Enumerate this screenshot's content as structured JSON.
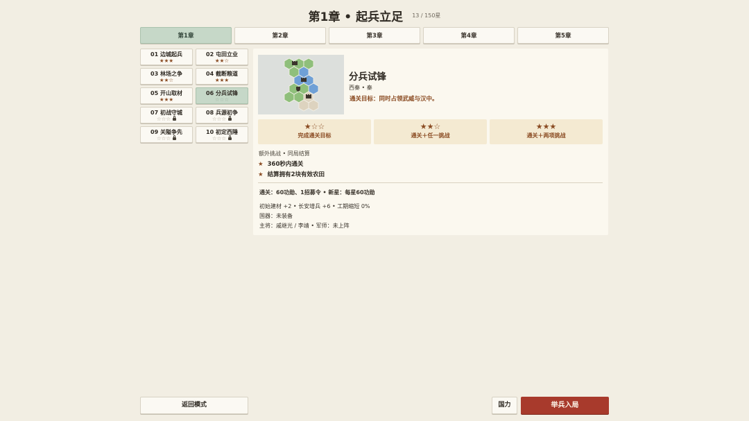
{
  "header": {
    "title": "第1章 • 起兵立足",
    "progress": "13 / 150星"
  },
  "chapter_tabs": [
    {
      "label": "第1章",
      "active": true
    },
    {
      "label": "第2章",
      "active": false
    },
    {
      "label": "第3章",
      "active": false
    },
    {
      "label": "第4章",
      "active": false
    },
    {
      "label": "第5章",
      "active": false
    }
  ],
  "levels": [
    {
      "name": "01  边城起兵",
      "stars": "★★★",
      "locked": false,
      "earned_stars": 3
    },
    {
      "name": "02  屯田立业",
      "stars": "★★☆",
      "locked": false,
      "earned_stars": 2
    },
    {
      "name": "03  林场之争",
      "stars": "★★☆",
      "locked": false,
      "earned_stars": 2
    },
    {
      "name": "04  截断粮道",
      "stars": "★★★",
      "locked": false,
      "earned_stars": 3
    },
    {
      "name": "05  开山取材",
      "stars": "★★★",
      "locked": false,
      "earned_stars": 3
    },
    {
      "name": "06  分兵试锋",
      "stars": "☆☆☆",
      "locked": false,
      "earned_stars": 0,
      "selected": true
    },
    {
      "name": "07  初战守城",
      "stars": "☆☆☆",
      "locked": true,
      "earned_stars": 0
    },
    {
      "name": "08  兵源初争",
      "stars": "☆☆☆",
      "locked": true,
      "earned_stars": 0
    },
    {
      "name": "09  关隘争先",
      "stars": "☆☆☆",
      "locked": true,
      "earned_stars": 0
    },
    {
      "name": "10  初定西陲",
      "stars": "☆☆☆",
      "locked": true,
      "earned_stars": 0
    }
  ],
  "detail": {
    "title": "分兵试锋",
    "factions": "西秦 • 秦",
    "objective": "通关目标：同时占领武威与汉中。",
    "tiers": [
      {
        "stars": "★☆☆",
        "label": "完成通关目标"
      },
      {
        "stars": "★★☆",
        "label": "通关＋任一挑战"
      },
      {
        "stars": "★★★",
        "label": "通关＋两项挑战"
      }
    ],
    "extra_heading": "额外挑战 • 同局结算",
    "challenges": [
      {
        "star": "★",
        "text": "360秒内通关"
      },
      {
        "star": "★",
        "text": "结算拥有2块有效农田"
      }
    ],
    "rewards": "通关：60功勋、1招募令 • 新星：每星60功勋",
    "bonuses": "初始建材 +2 • 长安增兵 +6 • 工期缩短 0%",
    "equipment": "国器：未装备",
    "commanders": "主将：戚继光 / 李靖 • 军师：未上阵"
  },
  "footer": {
    "back_label": "返回模式",
    "guoli_label": "国力",
    "start_label": "举兵入局"
  },
  "colors": {
    "background": "#f2eee3",
    "active_tab": "#c6d8c8",
    "star_brown": "#8a4b22",
    "start_button": "#a83a2c",
    "map_green": "#8fbf7b",
    "map_blue": "#6fa0d6",
    "map_beige": "#ddd3bf"
  }
}
